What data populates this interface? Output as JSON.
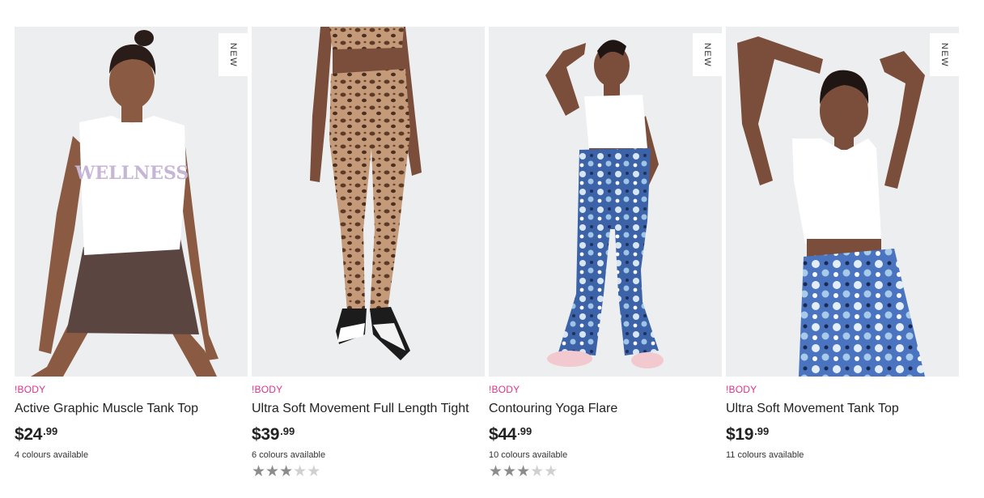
{
  "products": [
    {
      "brand": "!BODY",
      "name": "Active Graphic Muscle Tank Top",
      "price_dollars": "$24",
      "price_cents": ".99",
      "colours": "4 colours available",
      "badge": "NEW",
      "rating": null,
      "image_icon": "model-photo"
    },
    {
      "brand": "!BODY",
      "name": "Ultra Soft Movement Full Length Tight",
      "price_dollars": "$39",
      "price_cents": ".99",
      "colours": "6 colours available",
      "badge": null,
      "rating": 3,
      "image_icon": "model-photo"
    },
    {
      "brand": "!BODY",
      "name": "Contouring Yoga Flare",
      "price_dollars": "$44",
      "price_cents": ".99",
      "colours": "10 colours available",
      "badge": "NEW",
      "rating": 3,
      "image_icon": "model-photo"
    },
    {
      "brand": "!BODY",
      "name": "Ultra Soft Movement Tank Top",
      "price_dollars": "$19",
      "price_cents": ".99",
      "colours": "11 colours available",
      "badge": "NEW",
      "rating": null,
      "image_icon": "model-photo"
    }
  ],
  "rating_max": 5,
  "colors": {
    "brand": "#e0318a",
    "image_bg": "#eceeef",
    "star_on": "#8c8c8c",
    "star_off": "#d0d0d0"
  }
}
